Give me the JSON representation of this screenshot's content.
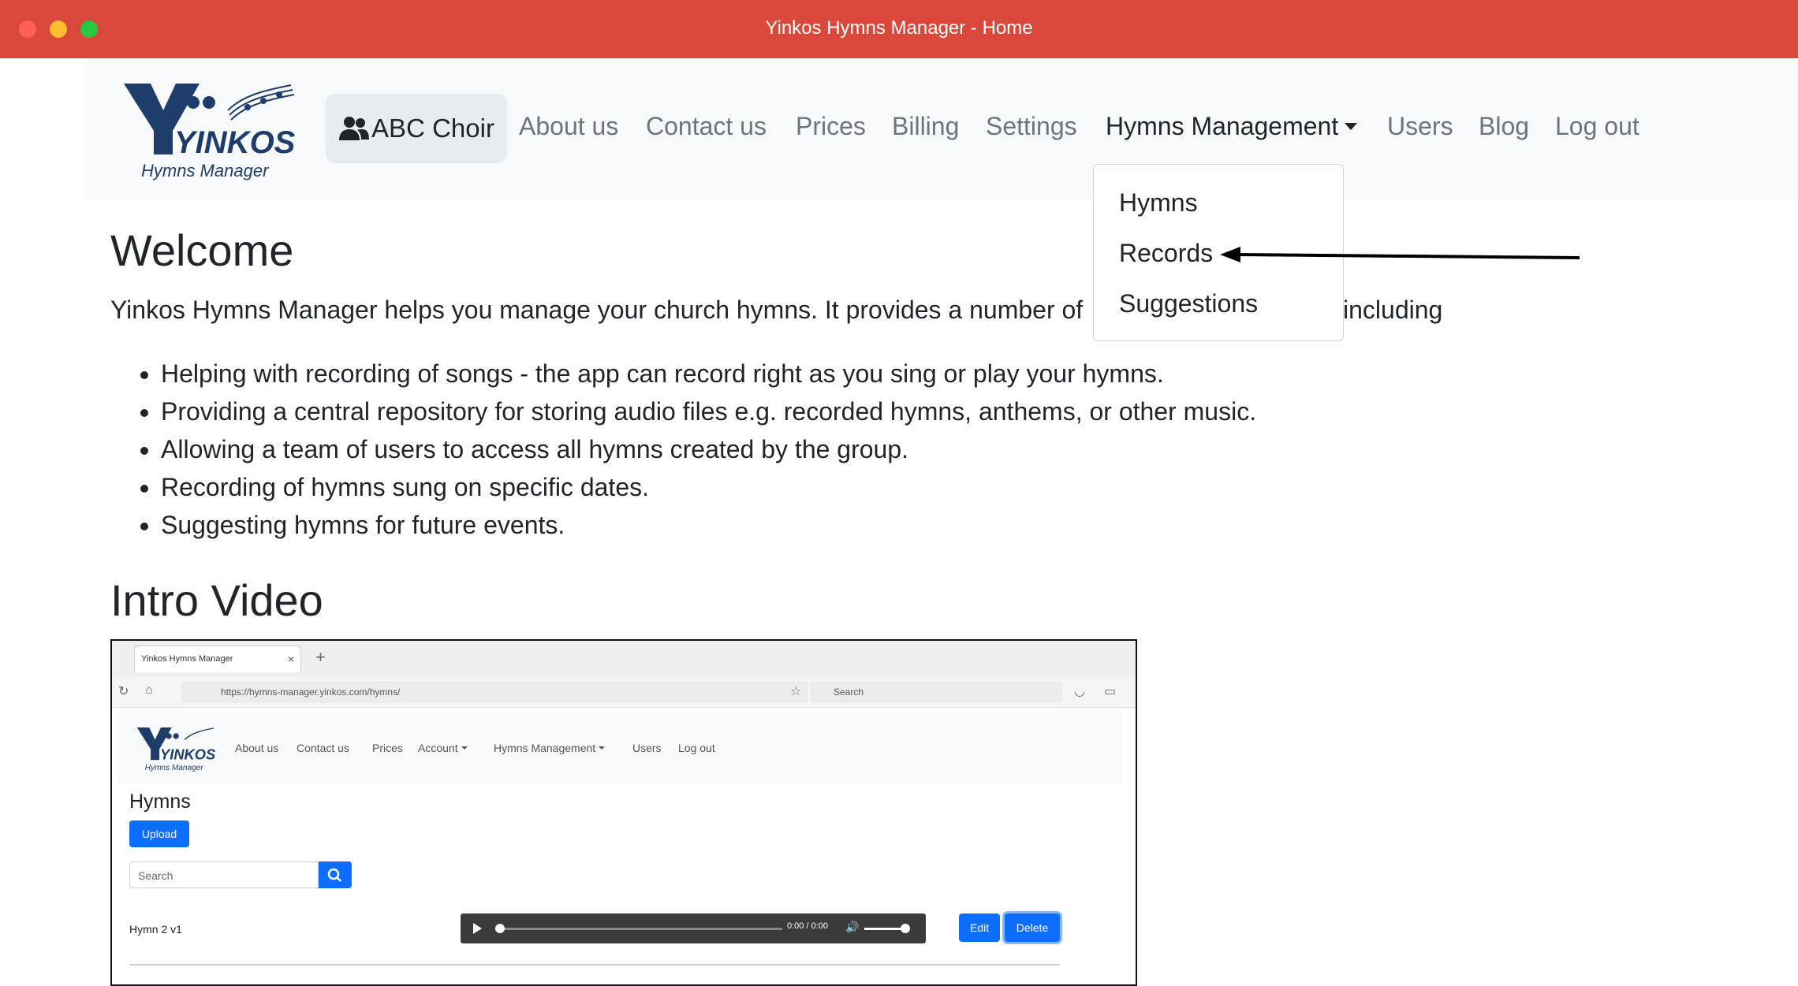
{
  "window": {
    "title": "Yinkos Hymns Manager - Home"
  },
  "navbar": {
    "logo_text": "YINKOS",
    "logo_subtext": "Hymns Manager",
    "choir_label": "ABC Choir",
    "links": {
      "about": "About us",
      "contact": "Contact us",
      "prices": "Prices",
      "billing": "Billing",
      "settings": "Settings",
      "hymns_management": "Hymns Management",
      "users": "Users",
      "blog": "Blog",
      "logout": "Log out"
    }
  },
  "dropdown": {
    "items": [
      "Hymns",
      "Records",
      "Suggestions"
    ]
  },
  "main": {
    "welcome_heading": "Welcome",
    "intro_text": "Yinkos Hymns Manager helps you manage your church hymns. It provides a number of",
    "intro_tail": "including",
    "features": [
      "Helping with recording of songs - the app can record right as you sing or play your hymns.",
      "Providing a central repository for storing audio files e.g. recorded hymns, anthems, or other music.",
      "Allowing a team of users to access all hymns created by the group.",
      "Recording of hymns sung on specific dates.",
      "Suggesting hymns for future events."
    ],
    "video_heading": "Intro Video"
  },
  "video": {
    "tab_title": "Yinkos Hymns Manager",
    "url": "https://hymns-manager.yinkos.com/hymns/",
    "search_placeholder": "Search",
    "nav": {
      "about": "About us",
      "contact": "Contact us",
      "prices": "Prices",
      "account": "Account",
      "hymns_management": "Hymns Management",
      "users": "Users",
      "logout": "Log out"
    },
    "page_heading": "Hymns",
    "upload_label": "Upload",
    "search_input_placeholder": "Search",
    "hymn_name": "Hymn 2 v1",
    "player_time": "0:00 / 0:00",
    "edit_label": "Edit",
    "delete_label": "Delete"
  }
}
